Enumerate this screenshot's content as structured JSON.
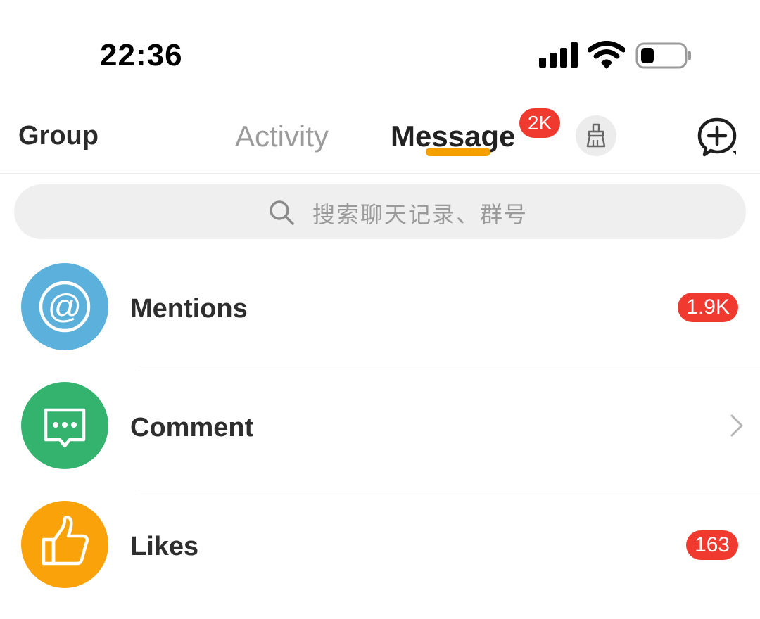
{
  "status_bar": {
    "time": "22:36",
    "icons": [
      "cellular-signal-icon",
      "wifi-icon",
      "battery-icon"
    ]
  },
  "nav": {
    "group_label": "Group",
    "tabs": [
      {
        "label": "Activity",
        "active": false
      },
      {
        "label": "Message",
        "active": true,
        "badge": "2K"
      }
    ],
    "clean_icon": "broom-icon",
    "new_chat_icon": "chat-plus-icon"
  },
  "search": {
    "placeholder": "搜索聊天记录、群号",
    "icon": "search-icon"
  },
  "items": [
    {
      "label": "Mentions",
      "icon": "at-sign-icon",
      "color": "#5bb0dc",
      "badge": "1.9K"
    },
    {
      "label": "Comment",
      "icon": "speech-bubble-icon",
      "color": "#34b36e",
      "badge": null
    },
    {
      "label": "Likes",
      "icon": "thumbs-up-icon",
      "color": "#f9a20a",
      "badge": "163"
    }
  ],
  "colors": {
    "badge_red": "#f03a30",
    "accent_orange": "#f5a000"
  }
}
